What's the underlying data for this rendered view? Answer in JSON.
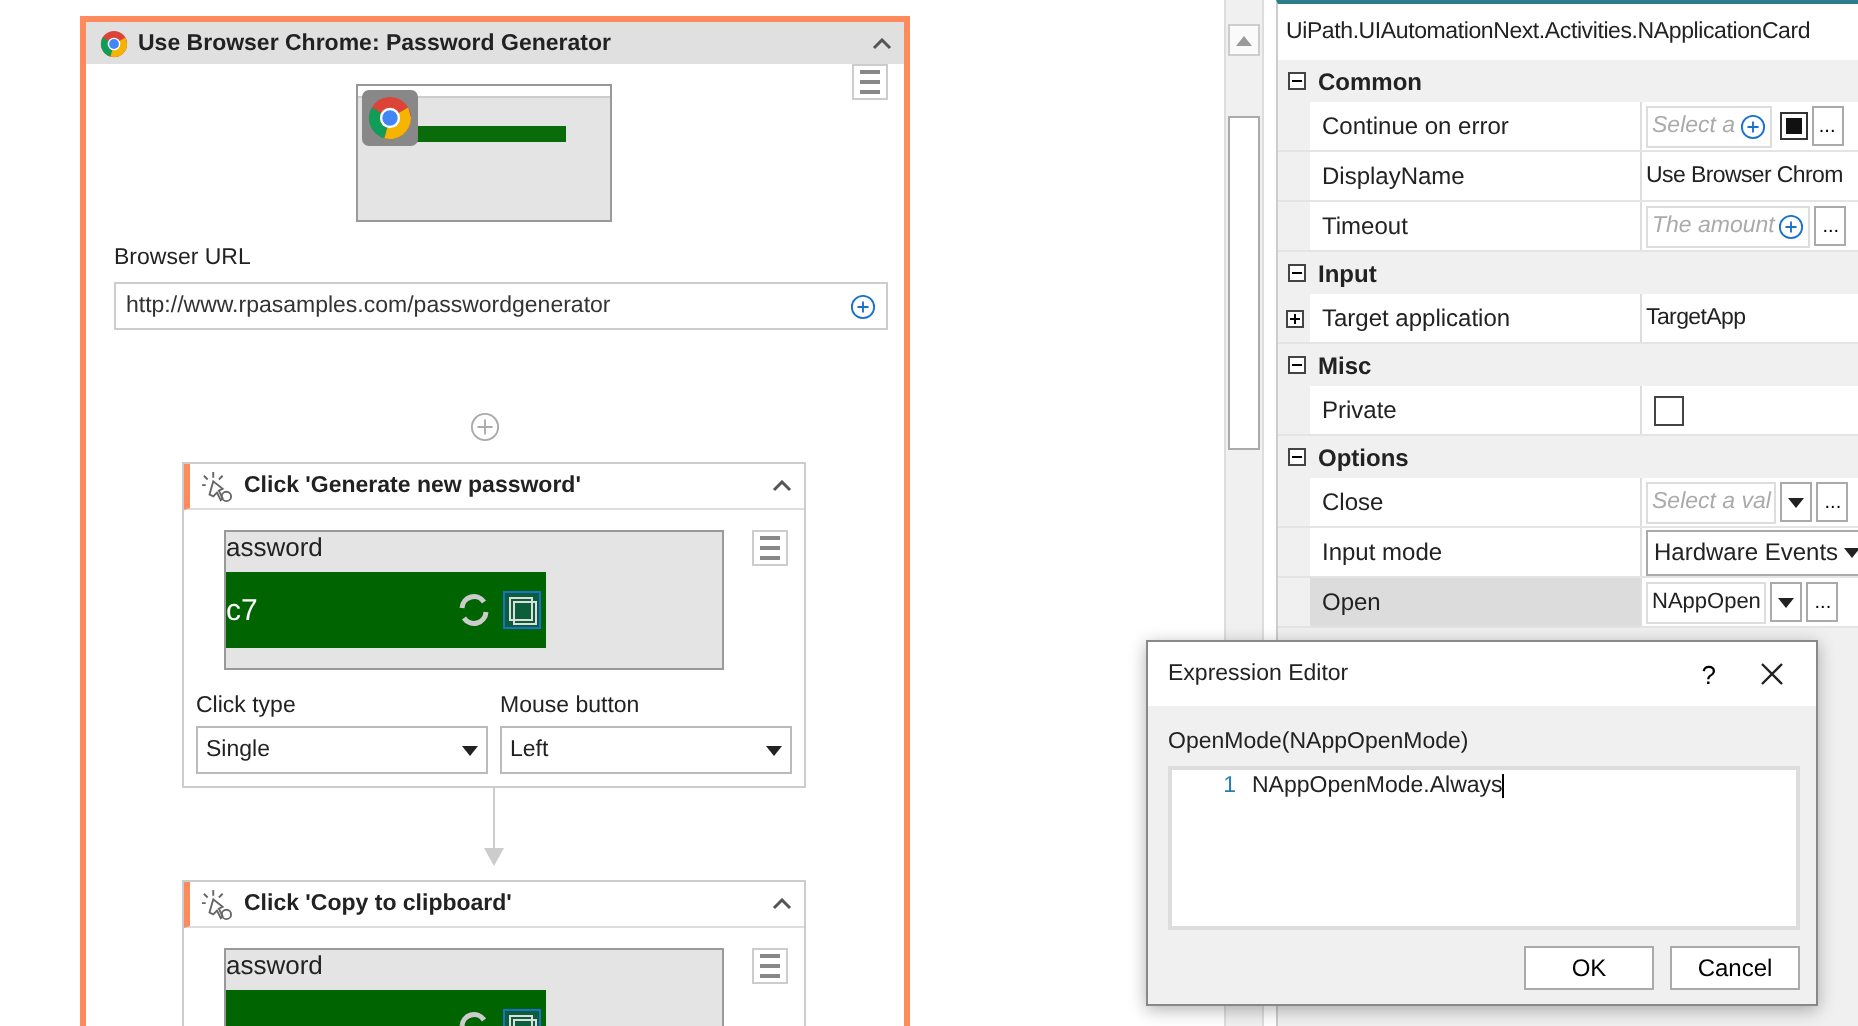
{
  "designer": {
    "scope": {
      "title": "Use Browser Chrome: Password Generator",
      "url_label": "Browser URL",
      "url_value": "http://www.rpasamples.com/passwordgenerator",
      "activities": [
        {
          "title": "Click 'Generate new password'",
          "preview_texts": [
            "assword",
            "c7"
          ],
          "fields": [
            {
              "label": "Click type",
              "value": "Single"
            },
            {
              "label": "Mouse button",
              "value": "Left"
            }
          ]
        },
        {
          "title": "Click 'Copy to clipboard'",
          "preview_texts": [
            "assword"
          ]
        }
      ]
    }
  },
  "properties": {
    "title": "UiPath.UIAutomationNext.Activities.NApplicationCard",
    "categories": [
      {
        "name": "Common",
        "expanded": true,
        "rows": [
          {
            "name": "Continue on error",
            "kind": "expr",
            "placeholder": "Select a",
            "checked": true,
            "ellipsis": "...",
            "selected": false
          },
          {
            "name": "DisplayName",
            "kind": "text",
            "value": "Use Browser Chrom",
            "selected": false
          },
          {
            "name": "Timeout",
            "kind": "expr",
            "placeholder": "The amount",
            "ellipsis": "...",
            "selected": false
          }
        ]
      },
      {
        "name": "Input",
        "expanded": true,
        "rows": [
          {
            "name": "Target application",
            "kind": "text",
            "value": "TargetApp",
            "expanded": false,
            "selected": false
          }
        ]
      },
      {
        "name": "Misc",
        "expanded": true,
        "rows": [
          {
            "name": "Private",
            "kind": "checkbox",
            "checked": false,
            "selected": false
          }
        ]
      },
      {
        "name": "Options",
        "expanded": true,
        "rows": [
          {
            "name": "Close",
            "kind": "expr-combo",
            "placeholder": "Select a val",
            "ellipsis": "...",
            "selected": false
          },
          {
            "name": "Input mode",
            "kind": "combo",
            "value": "Hardware Events",
            "selected": false
          },
          {
            "name": "Open",
            "kind": "expr-combo",
            "value": "NAppOpen",
            "ellipsis": "...",
            "selected": true
          }
        ]
      }
    ]
  },
  "dialog": {
    "title": "Expression Editor",
    "help": "?",
    "label": "OpenMode(NAppOpenMode)",
    "lines": [
      {
        "number": "1",
        "code": "NAppOpenMode.Always"
      }
    ],
    "buttons": [
      "OK",
      "Cancel"
    ]
  }
}
